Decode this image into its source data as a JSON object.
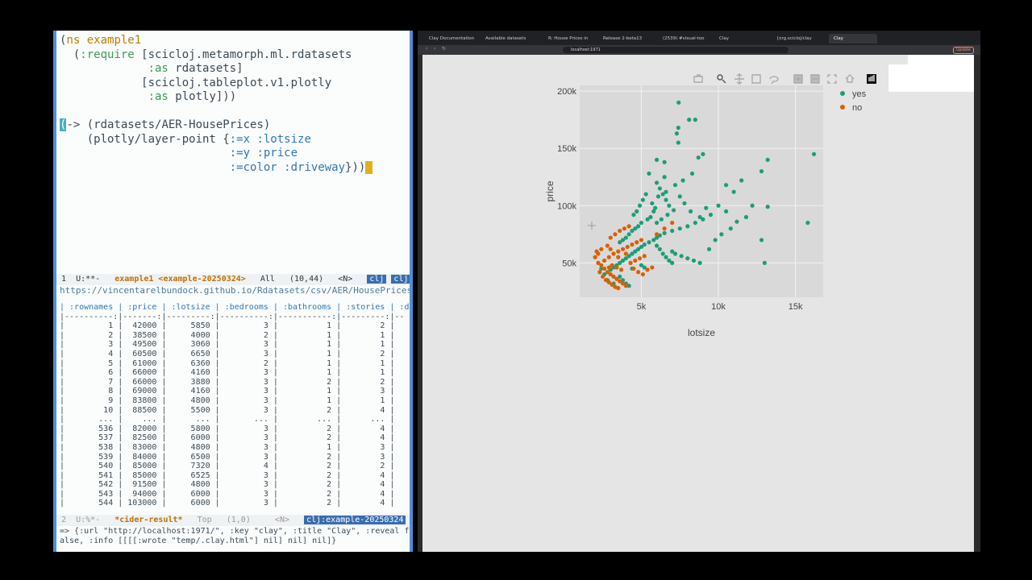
{
  "editor": {
    "code_lines": [
      "(ns example1",
      "  (:require [scicloj.metamorph.ml.rdatasets",
      "             :as rdatasets]",
      "            [scicloj.tableplot.v1.plotly",
      "             :as plotly]))",
      "",
      "(-> (rdatasets/AER-HousePrices)",
      "    (plotly/layer-point {:=x :lotsize",
      "                         :=y :price",
      "                         :=color :driveway}))"
    ],
    "modeline1": {
      "prefix": " 1  U:**-   ",
      "buffer": "example1 <example-20250324>",
      "pos": "   All   (10,44)   <N>   ",
      "tag1": "clj",
      "tag2": "clj:s"
    },
    "url_line": "https://vincentarelbundock.github.io/Rdatasets/csv/AER/HousePrices.csv [",
    "table_header": "| :rownames | :price | :lotsize | :bedrooms | :bathrooms | :stories | :d",
    "table_sep": "|----------:|-------:|---------:|----------:|-----------:|---------:|--",
    "table_rows": [
      "|         1 |  42000 |     5850 |         3 |          1 |        2 |",
      "|         2 |  38500 |     4000 |         2 |          1 |        1 |",
      "|         3 |  49500 |     3060 |         3 |          1 |        1 |",
      "|         4 |  60500 |     6650 |         3 |          1 |        2 |",
      "|         5 |  61000 |     6360 |         2 |          1 |        1 |",
      "|         6 |  66000 |     4160 |         3 |          1 |        1 |",
      "|         7 |  66000 |     3880 |         3 |          2 |        2 |",
      "|         8 |  69000 |     4160 |         3 |          1 |        3 |",
      "|         9 |  83800 |     4800 |         3 |          1 |        1 |",
      "|        10 |  88500 |     5500 |         3 |          2 |        4 |",
      "|       ... |    ... |      ... |       ... |        ... |      ... |",
      "|       536 |  82000 |     5800 |         3 |          2 |        4 |",
      "|       537 |  82500 |     6000 |         3 |          2 |        4 |",
      "|       538 |  83000 |     4800 |         3 |          1 |        3 |",
      "|       539 |  84000 |     6500 |         3 |          2 |        3 |",
      "|       540 |  85000 |     7320 |         4 |          2 |        2 |",
      "|       541 |  85000 |     6525 |         3 |          2 |        4 |",
      "|       542 |  91500 |     4800 |         3 |          2 |        4 |",
      "|       543 |  94000 |     6000 |         3 |          2 |        4 |",
      "|       544 | 103000 |     6000 |         3 |          2 |        4 |"
    ],
    "modeline2": {
      "prefix": " 2  U:%*-   ",
      "buffer": "*cider-result*",
      "pos": "   Top   (1,0)     <N>   ",
      "tag1": "clj:example-20250324"
    },
    "echo_lines": [
      "=> {:url \"http://localhost:1971/\", :key \"clay\", :title \"Clay\", :reveal f",
      "alse, :info [[[[:wrote \"temp/.clay.html\"] nil] nil] nil]}"
    ]
  },
  "browser": {
    "tabs": [
      "Clay Documentation",
      "Available datasets",
      "R: House Prices in",
      "Release 2-beta13",
      "(2539) #visual-too",
      "Clay",
      "[org.scicloj/clay",
      "Clay"
    ],
    "url": "localhost:1971",
    "update_label": "Update"
  },
  "modebar_icons": [
    "camera-icon",
    "zoom-icon",
    "pan-icon",
    "box-select-icon",
    "lasso-icon",
    "zoom-in-icon",
    "zoom-out-icon",
    "autoscale-icon",
    "reset-icon",
    "plotly-logo-icon"
  ],
  "colors": {
    "yes": "#1b9e77",
    "no": "#d95f02",
    "plot_bg": "#e5e5e5",
    "paper_bg": "#e5e5e5"
  },
  "chart_data": {
    "type": "scatter",
    "xlabel": "lotsize",
    "ylabel": "price",
    "xticks": [
      "5k",
      "10k",
      "15k"
    ],
    "yticks": [
      "50k",
      "100k",
      "150k",
      "200k"
    ],
    "xlim": [
      1000,
      16800
    ],
    "ylim": [
      20000,
      205000
    ],
    "grid": true,
    "legend_position": "top-right",
    "series": [
      {
        "name": "yes",
        "color": "#1b9e77",
        "points": [
          [
            7420,
            190000
          ],
          [
            8500,
            175000
          ],
          [
            8100,
            175000
          ],
          [
            7400,
            168000
          ],
          [
            7300,
            163000
          ],
          [
            7400,
            155000
          ],
          [
            9000,
            145000
          ],
          [
            8700,
            142000
          ],
          [
            6000,
            140000
          ],
          [
            6500,
            138000
          ],
          [
            13200,
            140000
          ],
          [
            16200,
            145000
          ],
          [
            12800,
            130000
          ],
          [
            11500,
            122000
          ],
          [
            10500,
            118000
          ],
          [
            11000,
            112000
          ],
          [
            12200,
            100000
          ],
          [
            13200,
            99000
          ],
          [
            15800,
            85000
          ],
          [
            12800,
            70000
          ],
          [
            13000,
            50000
          ],
          [
            10000,
            100000
          ],
          [
            10500,
            95000
          ],
          [
            9500,
            92000
          ],
          [
            9000,
            88000
          ],
          [
            8500,
            85000
          ],
          [
            8000,
            82000
          ],
          [
            7500,
            80000
          ],
          [
            7000,
            78000
          ],
          [
            6500,
            76000
          ],
          [
            6200,
            74000
          ],
          [
            6000,
            72000
          ],
          [
            5800,
            70000
          ],
          [
            5500,
            68000
          ],
          [
            5200,
            66000
          ],
          [
            5000,
            64000
          ],
          [
            4800,
            62000
          ],
          [
            4600,
            60000
          ],
          [
            4400,
            58000
          ],
          [
            4200,
            56000
          ],
          [
            4000,
            54000
          ],
          [
            3800,
            52000
          ],
          [
            3600,
            50000
          ],
          [
            3400,
            48000
          ],
          [
            3200,
            46000
          ],
          [
            3000,
            44000
          ],
          [
            6800,
            100000
          ],
          [
            6600,
            105000
          ],
          [
            6400,
            110000
          ],
          [
            6200,
            115000
          ],
          [
            6000,
            120000
          ],
          [
            6500,
            125000
          ],
          [
            5500,
            128000
          ],
          [
            7500,
            108000
          ],
          [
            7800,
            102000
          ],
          [
            8200,
            95000
          ],
          [
            8800,
            90000
          ],
          [
            9200,
            98000
          ],
          [
            5800,
            95000
          ],
          [
            5600,
            90000
          ],
          [
            5400,
            88000
          ],
          [
            5000,
            85000
          ],
          [
            4800,
            82000
          ],
          [
            4600,
            80000
          ],
          [
            4400,
            78000
          ],
          [
            4200,
            75000
          ],
          [
            4000,
            72000
          ],
          [
            3800,
            70000
          ],
          [
            3600,
            68000
          ],
          [
            7000,
            60000
          ],
          [
            7200,
            58000
          ],
          [
            7600,
            56000
          ],
          [
            8000,
            54000
          ],
          [
            8400,
            52000
          ],
          [
            8800,
            50000
          ],
          [
            9400,
            62000
          ],
          [
            9800,
            70000
          ],
          [
            10200,
            75000
          ],
          [
            10800,
            80000
          ],
          [
            11200,
            86000
          ],
          [
            11800,
            90000
          ],
          [
            6000,
            65000
          ],
          [
            6200,
            62000
          ],
          [
            6400,
            58000
          ],
          [
            6600,
            55000
          ],
          [
            6800,
            52000
          ],
          [
            7000,
            50000
          ],
          [
            5000,
            48000
          ],
          [
            5200,
            46000
          ],
          [
            4400,
            45000
          ],
          [
            3600,
            38000
          ],
          [
            3800,
            35000
          ],
          [
            4000,
            32000
          ],
          [
            4200,
            30000
          ],
          [
            3200,
            32000
          ],
          [
            2800,
            35000
          ],
          [
            2600,
            40000
          ],
          [
            2400,
            45000
          ],
          [
            6000,
            85000
          ],
          [
            6300,
            88000
          ],
          [
            6700,
            92000
          ],
          [
            7100,
            96000
          ],
          [
            5900,
            98000
          ],
          [
            5700,
            102000
          ],
          [
            6100,
            108000
          ],
          [
            6600,
            112000
          ],
          [
            7200,
            118000
          ],
          [
            7700,
            122000
          ],
          [
            8300,
            128000
          ],
          [
            5300,
            110000
          ],
          [
            5100,
            105000
          ],
          [
            4900,
            100000
          ],
          [
            4700,
            95000
          ],
          [
            4500,
            92000
          ]
        ]
      },
      {
        "name": "no",
        "color": "#d95f02",
        "points": [
          [
            2200,
            50000
          ],
          [
            2400,
            48000
          ],
          [
            2600,
            45000
          ],
          [
            2800,
            42000
          ],
          [
            3000,
            40000
          ],
          [
            3200,
            38000
          ],
          [
            3400,
            36000
          ],
          [
            3600,
            34000
          ],
          [
            3800,
            32000
          ],
          [
            4000,
            30000
          ],
          [
            2500,
            38000
          ],
          [
            2700,
            35000
          ],
          [
            2900,
            33000
          ],
          [
            3100,
            31000
          ],
          [
            3300,
            29000
          ],
          [
            3500,
            28000
          ],
          [
            2300,
            42000
          ],
          [
            2600,
            52000
          ],
          [
            2900,
            55000
          ],
          [
            3200,
            58000
          ],
          [
            3500,
            60000
          ],
          [
            3800,
            62000
          ],
          [
            4100,
            64000
          ],
          [
            4400,
            66000
          ],
          [
            4700,
            68000
          ],
          [
            5000,
            70000
          ],
          [
            3000,
            72000
          ],
          [
            3300,
            75000
          ],
          [
            3600,
            78000
          ],
          [
            3900,
            80000
          ],
          [
            4200,
            82000
          ],
          [
            2100,
            60000
          ],
          [
            2400,
            62000
          ],
          [
            2800,
            65000
          ],
          [
            4500,
            45000
          ],
          [
            4800,
            42000
          ],
          [
            5100,
            40000
          ],
          [
            5400,
            44000
          ],
          [
            5700,
            46000
          ],
          [
            3700,
            44000
          ],
          [
            3400,
            46000
          ],
          [
            3100,
            48000
          ],
          [
            2900,
            46000
          ],
          [
            4300,
            50000
          ],
          [
            4600,
            52000
          ],
          [
            4900,
            54000
          ],
          [
            5200,
            56000
          ],
          [
            6000,
            75000
          ],
          [
            6500,
            80000
          ],
          [
            7000,
            85000
          ],
          [
            2000,
            55000
          ],
          [
            2200,
            58000
          ],
          [
            3500,
            55000
          ],
          [
            4000,
            58000
          ],
          [
            3000,
            62000
          ]
        ]
      }
    ]
  }
}
